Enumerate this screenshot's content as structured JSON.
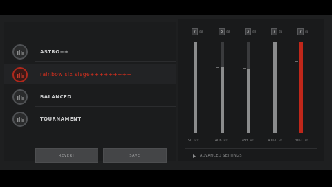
{
  "presets": [
    {
      "label": "ASTRO++",
      "icon": "bars-icon",
      "selected": false
    },
    {
      "label": "rainbow six siege+++++++++",
      "icon": "bars-icon",
      "selected": true
    },
    {
      "label": "BALANCED",
      "icon": "bars-icon",
      "selected": false
    },
    {
      "label": "TOURNAMENT",
      "icon": "bars-icon",
      "selected": false
    }
  ],
  "buttons": {
    "revert": "REVERT",
    "save": "SAVE"
  },
  "eq": {
    "db_unit": "dB",
    "hz_unit": "Hz",
    "bands": [
      {
        "freq": "90",
        "db": "7",
        "level": 1.0,
        "active": false
      },
      {
        "freq": "406",
        "db": "3",
        "level": 0.72,
        "active": false
      },
      {
        "freq": "783",
        "db": "3",
        "level": 0.7,
        "active": false
      },
      {
        "freq": "4061",
        "db": "7",
        "level": 1.0,
        "active": false
      },
      {
        "freq": "7061",
        "db": "7",
        "level": 1.0,
        "active": true
      }
    ],
    "advanced_label": "ADVANCED SETTINGS"
  },
  "colors": {
    "accent": "#c0271a",
    "panel": "#1e1f20"
  }
}
